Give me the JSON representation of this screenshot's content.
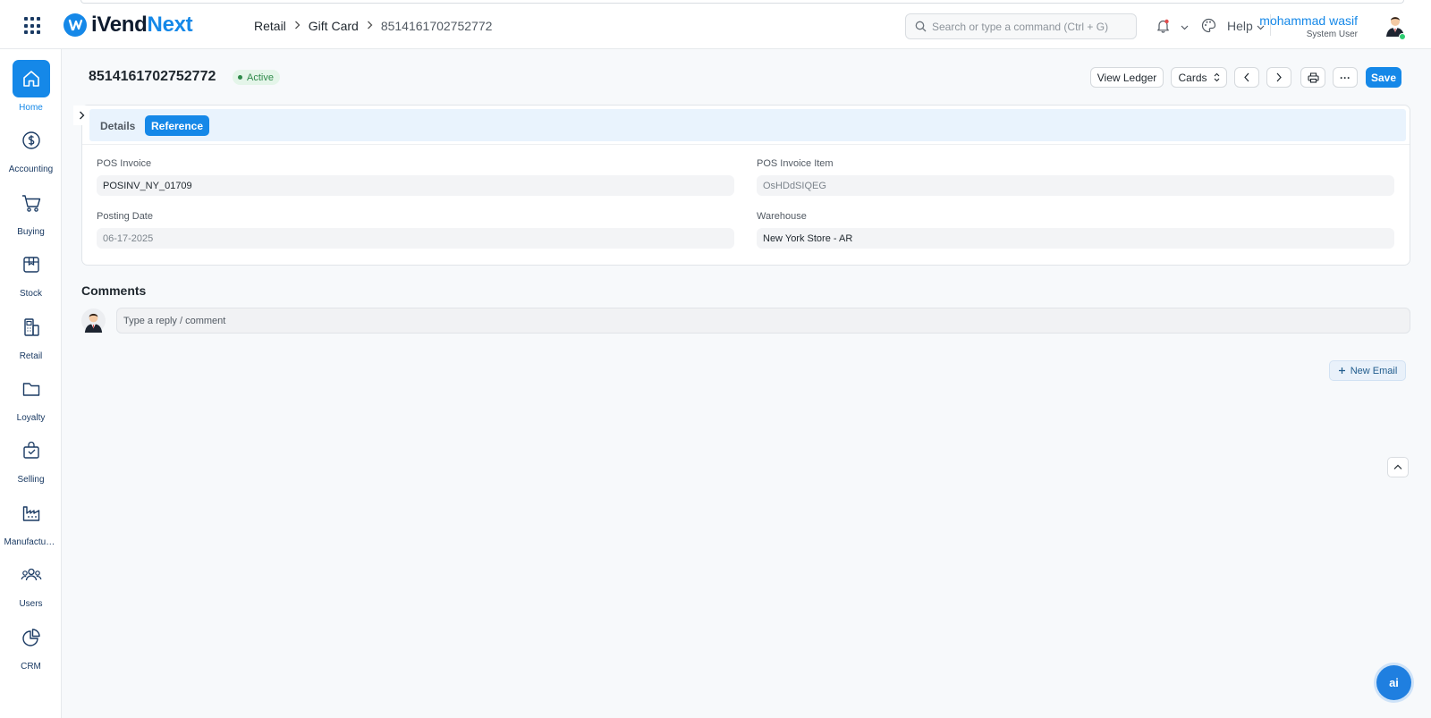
{
  "header": {
    "logo_left": "iVend",
    "logo_right": "Next",
    "breadcrumb": [
      "Retail",
      "Gift Card",
      "8514161702752772"
    ],
    "search_placeholder": "Search or type a command (Ctrl + G)",
    "help_label": "Help",
    "user_name": "mohammad wasif",
    "user_role": "System User"
  },
  "sidebar": {
    "items": [
      {
        "label": "Home",
        "icon": "home-icon",
        "active": true
      },
      {
        "label": "Accounting",
        "icon": "dollar-icon"
      },
      {
        "label": "Buying",
        "icon": "cart-icon"
      },
      {
        "label": "Stock",
        "icon": "box-icon"
      },
      {
        "label": "Retail",
        "icon": "pos-terminal-icon"
      },
      {
        "label": "Loyalty",
        "icon": "folder-icon"
      },
      {
        "label": "Selling",
        "icon": "shopping-bag-icon"
      },
      {
        "label": "Manufacturing",
        "icon": "factory-icon"
      },
      {
        "label": "Users",
        "icon": "users-icon"
      },
      {
        "label": "CRM",
        "icon": "pie-chart-icon"
      }
    ]
  },
  "document": {
    "title": "8514161702752772",
    "status": "Active",
    "actions": {
      "view_ledger": "View Ledger",
      "cards": "Cards",
      "more": "···",
      "save": "Save"
    }
  },
  "tabs": [
    {
      "label": "Details",
      "active": false
    },
    {
      "label": "Reference",
      "active": true
    }
  ],
  "fields": {
    "pos_invoice": {
      "label": "POS Invoice",
      "value": "POSINV_NY_01709"
    },
    "pos_invoice_item": {
      "label": "POS Invoice Item",
      "value": "OsHDdSIQEG"
    },
    "posting_date": {
      "label": "Posting Date",
      "value": "06-17-2025"
    },
    "warehouse": {
      "label": "Warehouse",
      "value": "New York Store - AR"
    }
  },
  "comments": {
    "title": "Comments",
    "placeholder": "Type a reply / comment",
    "new_email": "New Email"
  },
  "ai_button_label": "ai",
  "colors": {
    "accent": "#1588e8",
    "status_green": "#2f8a4a",
    "status_bg": "#e4f5e9"
  }
}
